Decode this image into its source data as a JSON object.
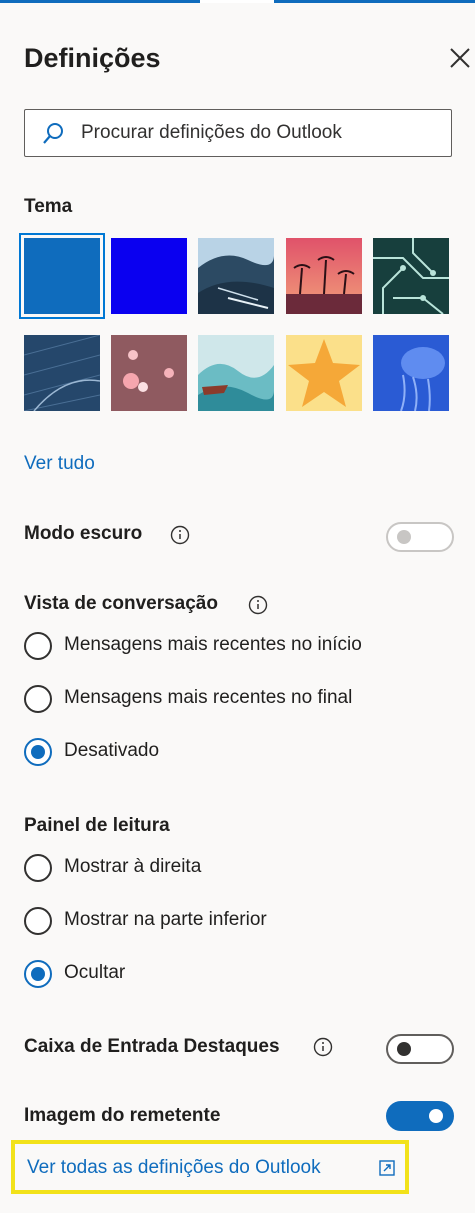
{
  "header": {
    "title": "Definições"
  },
  "search": {
    "placeholder": "Procurar definições do Outlook"
  },
  "theme": {
    "label": "Tema",
    "see_all": "Ver tudo",
    "swatches": [
      {
        "name": "blue",
        "selected": true
      },
      {
        "name": "bright-blue",
        "selected": false
      },
      {
        "name": "mountain",
        "selected": false
      },
      {
        "name": "palm-sunset",
        "selected": false
      },
      {
        "name": "circuit",
        "selected": false
      },
      {
        "name": "blueprint",
        "selected": false
      },
      {
        "name": "bokeh",
        "selected": false
      },
      {
        "name": "waves",
        "selected": false
      },
      {
        "name": "star",
        "selected": false
      },
      {
        "name": "jellyfish",
        "selected": false
      }
    ]
  },
  "dark_mode": {
    "label": "Modo escuro",
    "enabled": false,
    "disabled": true
  },
  "conversation_view": {
    "label": "Vista de conversação",
    "options": [
      {
        "label": "Mensagens mais recentes no início",
        "checked": false
      },
      {
        "label": "Mensagens mais recentes no final",
        "checked": false
      },
      {
        "label": "Desativado",
        "checked": true
      }
    ]
  },
  "reading_pane": {
    "label": "Painel de leitura",
    "options": [
      {
        "label": "Mostrar à direita",
        "checked": false
      },
      {
        "label": "Mostrar na parte inferior",
        "checked": false
      },
      {
        "label": "Ocultar",
        "checked": true
      }
    ]
  },
  "focused_inbox": {
    "label": "Caixa de Entrada Destaques",
    "enabled": false
  },
  "sender_image": {
    "label": "Imagem do remetente",
    "enabled": true
  },
  "footer": {
    "link": "Ver todas as definições do Outlook"
  },
  "colors": {
    "accent": "#0f6cbd",
    "highlight": "#f2e21a",
    "panel": "#faf9f8"
  }
}
